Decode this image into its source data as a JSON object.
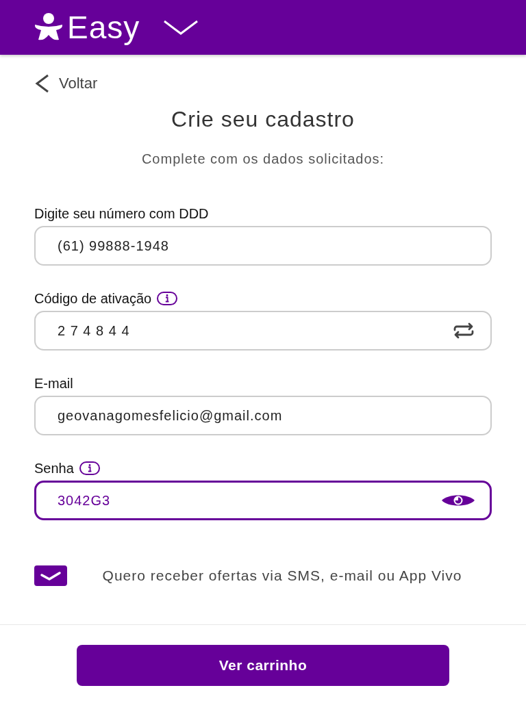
{
  "header": {
    "brand": "Easy",
    "menu_expanded": false
  },
  "back_link": {
    "label": "Voltar"
  },
  "title": "Crie seu cadastro",
  "subtitle": "Complete com os dados solicitados:",
  "fields": [
    {
      "label": "Digite seu número com DDD",
      "value": "(61) 99888-1948",
      "info": false,
      "kind": "plain",
      "focused": false
    },
    {
      "label": "Código de ativação",
      "value": "2 7 4 8 4 4",
      "info": true,
      "kind": "refresh",
      "focused": false
    },
    {
      "label": "E-mail",
      "value": "geovanagomesfelicio@gmail.com",
      "info": false,
      "kind": "plain",
      "focused": false
    },
    {
      "label": "Senha",
      "value": "3042G3",
      "info": true,
      "kind": "eye",
      "focused": true
    }
  ],
  "consent": {
    "label": "Quero receber ofertas via SMS, e-mail ou App Vivo",
    "checked": true
  },
  "footer": {
    "button": "Ver carrinho"
  }
}
